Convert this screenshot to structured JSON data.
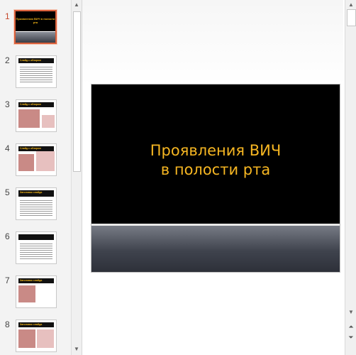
{
  "slides": [
    {
      "number": "1",
      "title": "Проявления ВИЧ в полости рта",
      "active": true
    },
    {
      "number": "2",
      "header": "Слайд с обзором"
    },
    {
      "number": "3",
      "header": "Слайд с обзором"
    },
    {
      "number": "4",
      "header": "Слайд с обзором"
    },
    {
      "number": "5",
      "header": "Заголовок слайда"
    },
    {
      "number": "6",
      "header": ""
    },
    {
      "number": "7",
      "header": "Заголовок слайда"
    },
    {
      "number": "8",
      "header": "Заголовок слайда"
    }
  ],
  "current_slide": {
    "title_line1": "Проявления ВИЧ",
    "title_line2": "в полости рта"
  },
  "scrollbar": {
    "up_icon": "triangle-up",
    "down_icon": "triangle-down",
    "prev_slide_icon": "double-chevron-up",
    "next_slide_icon": "double-chevron-down"
  },
  "colors": {
    "title": "#f6b622",
    "slide_background": "#000000",
    "active_thumb_border": "#d9603b"
  }
}
